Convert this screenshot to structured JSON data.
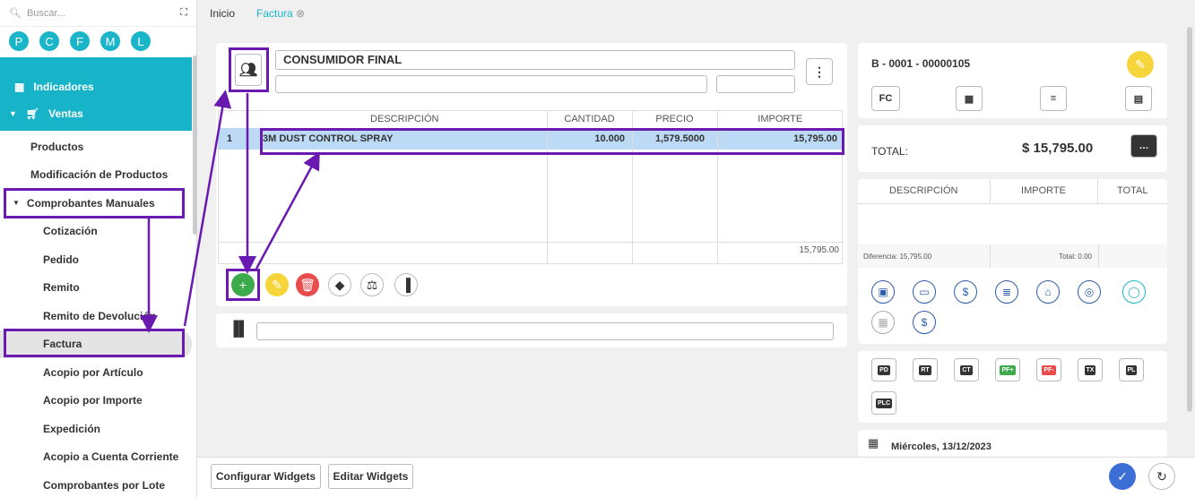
{
  "sidebar": {
    "search_placeholder": "Buscar...",
    "avatars": [
      "P",
      "C",
      "F",
      "M",
      "L"
    ],
    "sections": [
      {
        "label": "Indicadores",
        "icon": "grid-icon"
      },
      {
        "label": "Ventas",
        "icon": "cart-icon"
      }
    ],
    "items": [
      {
        "label": "Productos",
        "level": 1
      },
      {
        "label": "Modificación de Productos",
        "level": 1
      },
      {
        "label": "Comprobantes Manuales",
        "level": 1
      },
      {
        "label": "Cotización",
        "level": 2
      },
      {
        "label": "Pedido",
        "level": 2
      },
      {
        "label": "Remito",
        "level": 2
      },
      {
        "label": "Remito de Devolución",
        "level": 2
      },
      {
        "label": "Factura",
        "level": 2
      },
      {
        "label": "Acopio por Artículo",
        "level": 2
      },
      {
        "label": "Acopio por Importe",
        "level": 2
      },
      {
        "label": "Expedición",
        "level": 2
      },
      {
        "label": "Acopio a Cuenta Corriente",
        "level": 2
      },
      {
        "label": "Comprobantes por Lote",
        "level": 2
      }
    ]
  },
  "tabs": [
    "Inicio",
    "Factura"
  ],
  "customer": {
    "name": "CONSUMIDOR FINAL"
  },
  "grid": {
    "headers": [
      "DESCRIPCIÓN",
      "CANTIDAD",
      "PRECIO",
      "IMPORTE"
    ],
    "rows": [
      {
        "n": "1",
        "desc": "3M DUST CONTROL SPRAY",
        "qty": "10.000",
        "price": "1,579.5000",
        "amount": "15,795.00"
      }
    ],
    "total": "15,795.00"
  },
  "invoice": {
    "number": "B - 0001 - 00000105",
    "type_label": "FC",
    "total_label": "TOTAL:",
    "total_value": "$ 15,795.00"
  },
  "payments": {
    "headers": [
      "DESCRIPCIÓN",
      "IMPORTE",
      "TOTAL"
    ],
    "difference": "Diferencia: 15,795.00",
    "total": "Total: 0.00"
  },
  "doc_types": [
    "PD",
    "RT",
    "CT",
    "PF+",
    "PF-",
    "TX",
    "PL",
    "PLC"
  ],
  "date": "Miércoles, 13/12/2023",
  "footer": {
    "configure": "Configurar Widgets",
    "edit": "Editar Widgets"
  },
  "colors": {
    "accent": "#17b3c8",
    "highlight": "#6a1ab0",
    "selected_row": "#bcd9f5",
    "add": "#3daa4b",
    "edit": "#f5d53a",
    "delete": "#e84c4c",
    "confirm": "#3b6fd6"
  }
}
